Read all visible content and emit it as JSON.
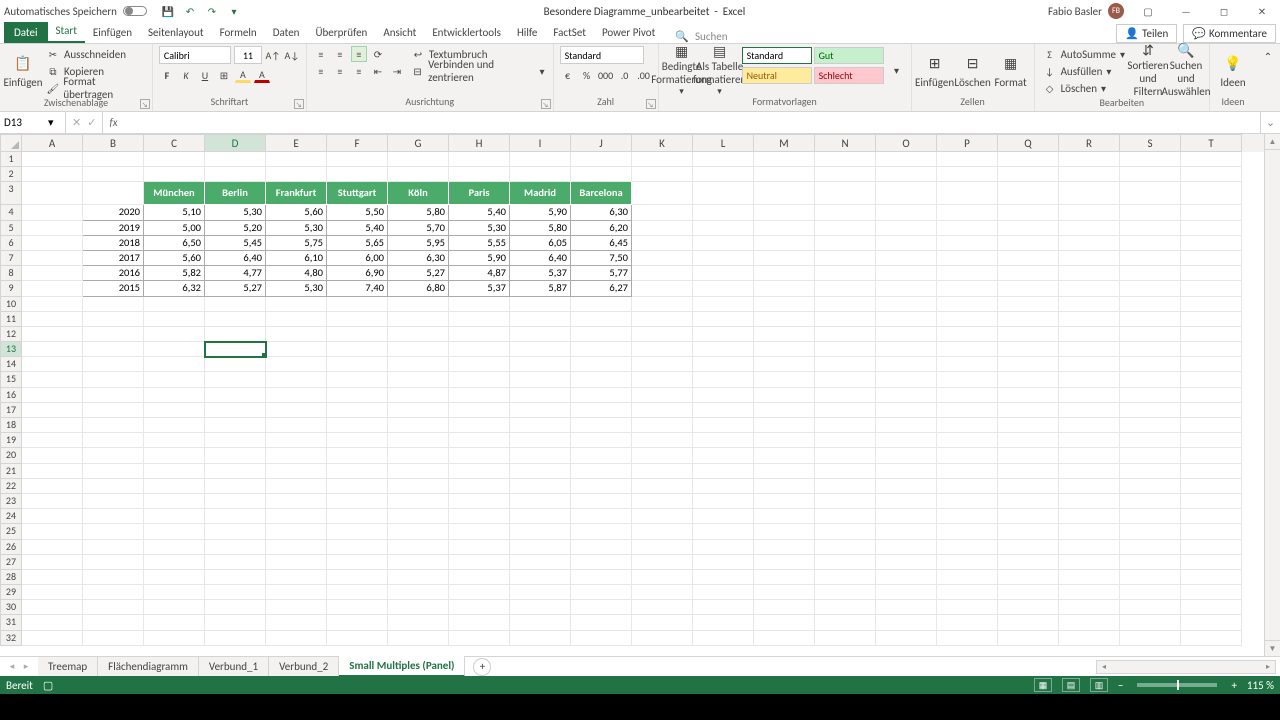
{
  "title": {
    "doc": "Besondere Diagramme_unbearbeitet",
    "app": "Excel",
    "autosave": "Automatisches Speichern"
  },
  "user": {
    "name": "Fabio Basler",
    "initials": "FB"
  },
  "tabs": {
    "file": "Datei",
    "start": "Start",
    "einf": "Einfügen",
    "layout": "Seitenlayout",
    "formeln": "Formeln",
    "daten": "Daten",
    "pruefen": "Überprüfen",
    "ansicht": "Ansicht",
    "dev": "Entwicklertools",
    "hilfe": "Hilfe",
    "factset": "FactSet",
    "pp": "Power Pivot",
    "search": "Suchen"
  },
  "share": {
    "teilen": "Teilen",
    "komm": "Kommentare"
  },
  "ribbon": {
    "clip": {
      "paste": "Einfügen",
      "cut": "Ausschneiden",
      "copy": "Kopieren",
      "format": "Format übertragen",
      "label": "Zwischenablage"
    },
    "font": {
      "name": "Calibri",
      "size": "11",
      "label": "Schriftart"
    },
    "align": {
      "wrap": "Textumbruch",
      "merge": "Verbinden und zentrieren",
      "label": "Ausrichtung"
    },
    "number": {
      "fmt": "Standard",
      "label": "Zahl"
    },
    "styles": {
      "cond": "Bedingte Formatierung",
      "table": "Als Tabelle formatieren",
      "std": "Standard",
      "gut": "Gut",
      "neutral": "Neutral",
      "schlecht": "Schlecht",
      "label": "Formatvorlagen"
    },
    "cells": {
      "ins": "Einfügen",
      "del": "Löschen",
      "fmt": "Format",
      "label": "Zellen"
    },
    "edit": {
      "sum": "AutoSumme",
      "fill": "Ausfüllen",
      "clear": "Löschen",
      "sort": "Sortieren und Filtern",
      "find": "Suchen und Auswählen",
      "label": "Bearbeiten"
    },
    "ideas": {
      "btn": "Ideen",
      "label": "Ideen"
    }
  },
  "fx": {
    "cellref": "D13"
  },
  "columns": [
    "A",
    "B",
    "C",
    "D",
    "E",
    "F",
    "G",
    "H",
    "I",
    "J",
    "K",
    "L",
    "M",
    "N",
    "O",
    "P",
    "Q",
    "R",
    "S",
    "T"
  ],
  "rows": [
    1,
    2,
    3,
    4,
    5,
    6,
    7,
    8,
    9,
    10,
    11,
    12,
    13,
    14,
    15,
    16,
    17,
    18,
    19,
    20,
    21,
    22,
    23,
    24,
    25,
    26,
    27,
    28,
    29,
    30,
    31,
    32
  ],
  "table": {
    "headers": [
      "München",
      "Berlin",
      "Frankfurt",
      "Stuttgart",
      "Köln",
      "Paris",
      "Madrid",
      "Barcelona"
    ],
    "rows": [
      {
        "year": "2020",
        "v": [
          "5,10",
          "5,30",
          "5,60",
          "5,50",
          "5,80",
          "5,40",
          "5,90",
          "6,30"
        ]
      },
      {
        "year": "2019",
        "v": [
          "5,00",
          "5,20",
          "5,30",
          "5,40",
          "5,70",
          "5,30",
          "5,80",
          "6,20"
        ]
      },
      {
        "year": "2018",
        "v": [
          "6,50",
          "5,45",
          "5,75",
          "5,65",
          "5,95",
          "5,55",
          "6,05",
          "6,45"
        ]
      },
      {
        "year": "2017",
        "v": [
          "5,60",
          "6,40",
          "6,10",
          "6,00",
          "6,30",
          "5,90",
          "6,40",
          "7,50"
        ]
      },
      {
        "year": "2016",
        "v": [
          "5,82",
          "4,77",
          "4,80",
          "6,90",
          "5,27",
          "4,87",
          "5,37",
          "5,77"
        ]
      },
      {
        "year": "2015",
        "v": [
          "6,32",
          "5,27",
          "5,30",
          "7,40",
          "6,80",
          "5,37",
          "5,87",
          "6,27"
        ]
      }
    ]
  },
  "sheets": {
    "s1": "Treemap",
    "s2": "Flächendiagramm",
    "s3": "Verbund_1",
    "s4": "Verbund_2",
    "s5": "Small Multiples (Panel)"
  },
  "status": {
    "ready": "Bereit",
    "zoom": "115 %"
  }
}
